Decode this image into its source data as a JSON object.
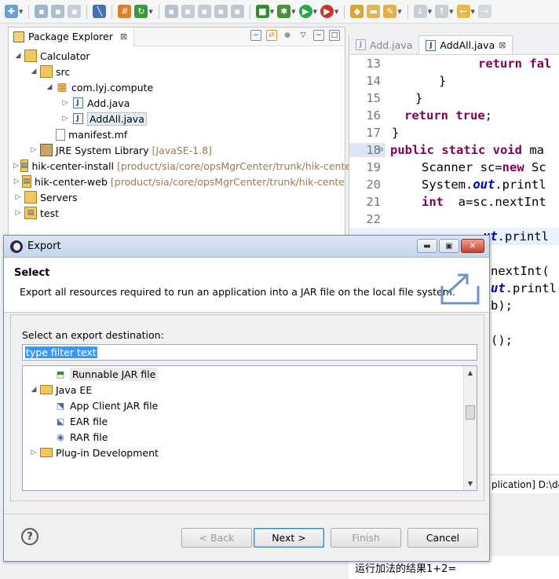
{
  "colors": {
    "keyword": "#7f0055",
    "field": "#0000c0",
    "selection": "#3399ff",
    "path": "#9a7b4f"
  },
  "package_explorer": {
    "tab_label": "Package Explorer",
    "tree": [
      {
        "label": "Calculator",
        "icon": "project-folder-icon"
      },
      {
        "label": "src",
        "icon": "source-folder-icon"
      },
      {
        "label": "com.lyj.compute",
        "icon": "package-icon"
      },
      {
        "label": "Add.java",
        "icon": "java-file-icon"
      },
      {
        "label": "AddAll.java",
        "icon": "java-file-icon"
      },
      {
        "label": "manifest.mf",
        "icon": "file-icon"
      },
      {
        "label": "JRE System Library",
        "path": "[JavaSE-1.8]",
        "icon": "library-icon"
      },
      {
        "label": "hik-center-install",
        "path": "[product/sia/core/opsMgrCenter/trunk/hik-cente",
        "icon": "svn-project-icon"
      },
      {
        "label": "hik-center-web",
        "path": "[product/sia/core/opsMgrCenter/trunk/hik-cente",
        "icon": "svn-project-icon"
      },
      {
        "label": "Servers",
        "icon": "folder-icon"
      },
      {
        "label": "test",
        "icon": "project-icon"
      }
    ]
  },
  "editor": {
    "tabs": [
      "Add.java",
      "AddAll.java"
    ],
    "lines": [
      {
        "n": "13"
      },
      {
        "n": "14"
      },
      {
        "n": "15"
      },
      {
        "n": "16"
      },
      {
        "n": "17"
      },
      {
        "n": "18"
      },
      {
        "n": "19"
      },
      {
        "n": "20"
      },
      {
        "n": "21"
      },
      {
        "n": "22"
      }
    ],
    "code": {
      "l13": "return fal",
      "l14": "}",
      "l15": "}",
      "l16_kw": "return true",
      "l16_end": ";",
      "l17": "}",
      "l18_kw": "public static void",
      "l18_rest": " ma",
      "l19_a": "Scanner sc=",
      "l19_kw": "new",
      "l19_b": " Sc",
      "l20_a": "System.",
      "l20_fld": "out",
      "l20_b": ".printl",
      "l21_kw": "int",
      "l21_rest": "  a=sc.nextInt",
      "frag1_fld": "ut",
      "frag1": ".printl",
      "frag2": "nextInt(",
      "frag3_fld": "ut",
      "frag3": ".printl",
      "frag4": "b);",
      "frag5": "();"
    }
  },
  "console": {
    "header_fragment": "plication] D:\\de",
    "output": "运行加法的结果1+2="
  },
  "dialog": {
    "title": "Export",
    "header_title": "Select",
    "header_desc": "Export all resources required to run an application into a JAR file on the local file system.",
    "body_label": "Select an export destination:",
    "filter_placeholder": "type filter text",
    "list": [
      {
        "label": "Runnable JAR file",
        "icon": "runnable-jar-icon",
        "indent": 2,
        "selected": true
      },
      {
        "label": "Java EE",
        "icon": "folder-open-icon",
        "indent": 0
      },
      {
        "label": "App Client JAR file",
        "icon": "app-client-jar-icon",
        "indent": 1
      },
      {
        "label": "EAR file",
        "icon": "ear-file-icon",
        "indent": 1
      },
      {
        "label": "RAR file",
        "icon": "rar-file-icon",
        "indent": 1
      },
      {
        "label": "Plug-in Development",
        "icon": "folder-icon",
        "indent": 0
      }
    ],
    "buttons": {
      "back": "< Back",
      "next": "Next >",
      "finish": "Finish",
      "cancel": "Cancel"
    }
  }
}
